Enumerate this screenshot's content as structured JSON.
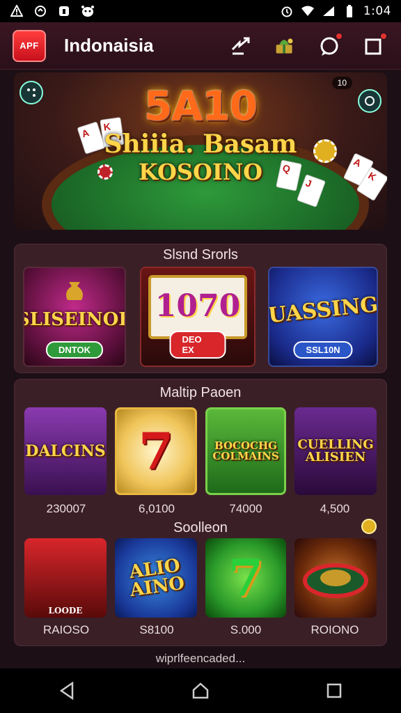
{
  "status_bar": {
    "time": "1:04",
    "icons": [
      "alert-icon",
      "sync-icon",
      "app-icon",
      "face-icon",
      "alarm-icon",
      "wifi-icon",
      "signal-icon",
      "battery-icon"
    ]
  },
  "app_header": {
    "logo_text": "APF",
    "title": "Indonaisia",
    "actions": [
      "share-icon",
      "gift-icon",
      "chat-icon",
      "edit-icon"
    ]
  },
  "banner": {
    "headline": "5A10",
    "line1": "Shiiia. Basam",
    "line2": "KOSOINO",
    "tag": "10"
  },
  "section_one": {
    "title": "Slsnd Srorls",
    "tiles": [
      {
        "name": "SLISEINOE",
        "button": "DNTOK"
      },
      {
        "name": "1070",
        "button": "DEO EX"
      },
      {
        "name": "UASSING",
        "button": "SSL10N"
      }
    ]
  },
  "section_two": {
    "title": "Maltip Paoen",
    "tiles": [
      {
        "name": "DALCINS",
        "value": "230007"
      },
      {
        "name": "7",
        "value": "6,0100"
      },
      {
        "name": "BOCOCHG COLMAINS",
        "value": "74000"
      },
      {
        "name": "CUELLING ALISIEN",
        "value": "4,500"
      }
    ],
    "subtitle": "Soolleon",
    "tiles2": [
      {
        "name": "LOODE",
        "value": "RAIOSO"
      },
      {
        "name": "ALIO AINO",
        "value": "S8100"
      },
      {
        "name": "7",
        "value": "S.000"
      },
      {
        "name": "ROULETTE",
        "value": "ROIONO"
      }
    ]
  },
  "footer": {
    "text": "wiprlfeencaded..."
  },
  "colors": {
    "background": "#1c0f16",
    "panel": "#3b1f27",
    "accent_red": "#d8262b",
    "accent_gold": "#ffd54a"
  }
}
